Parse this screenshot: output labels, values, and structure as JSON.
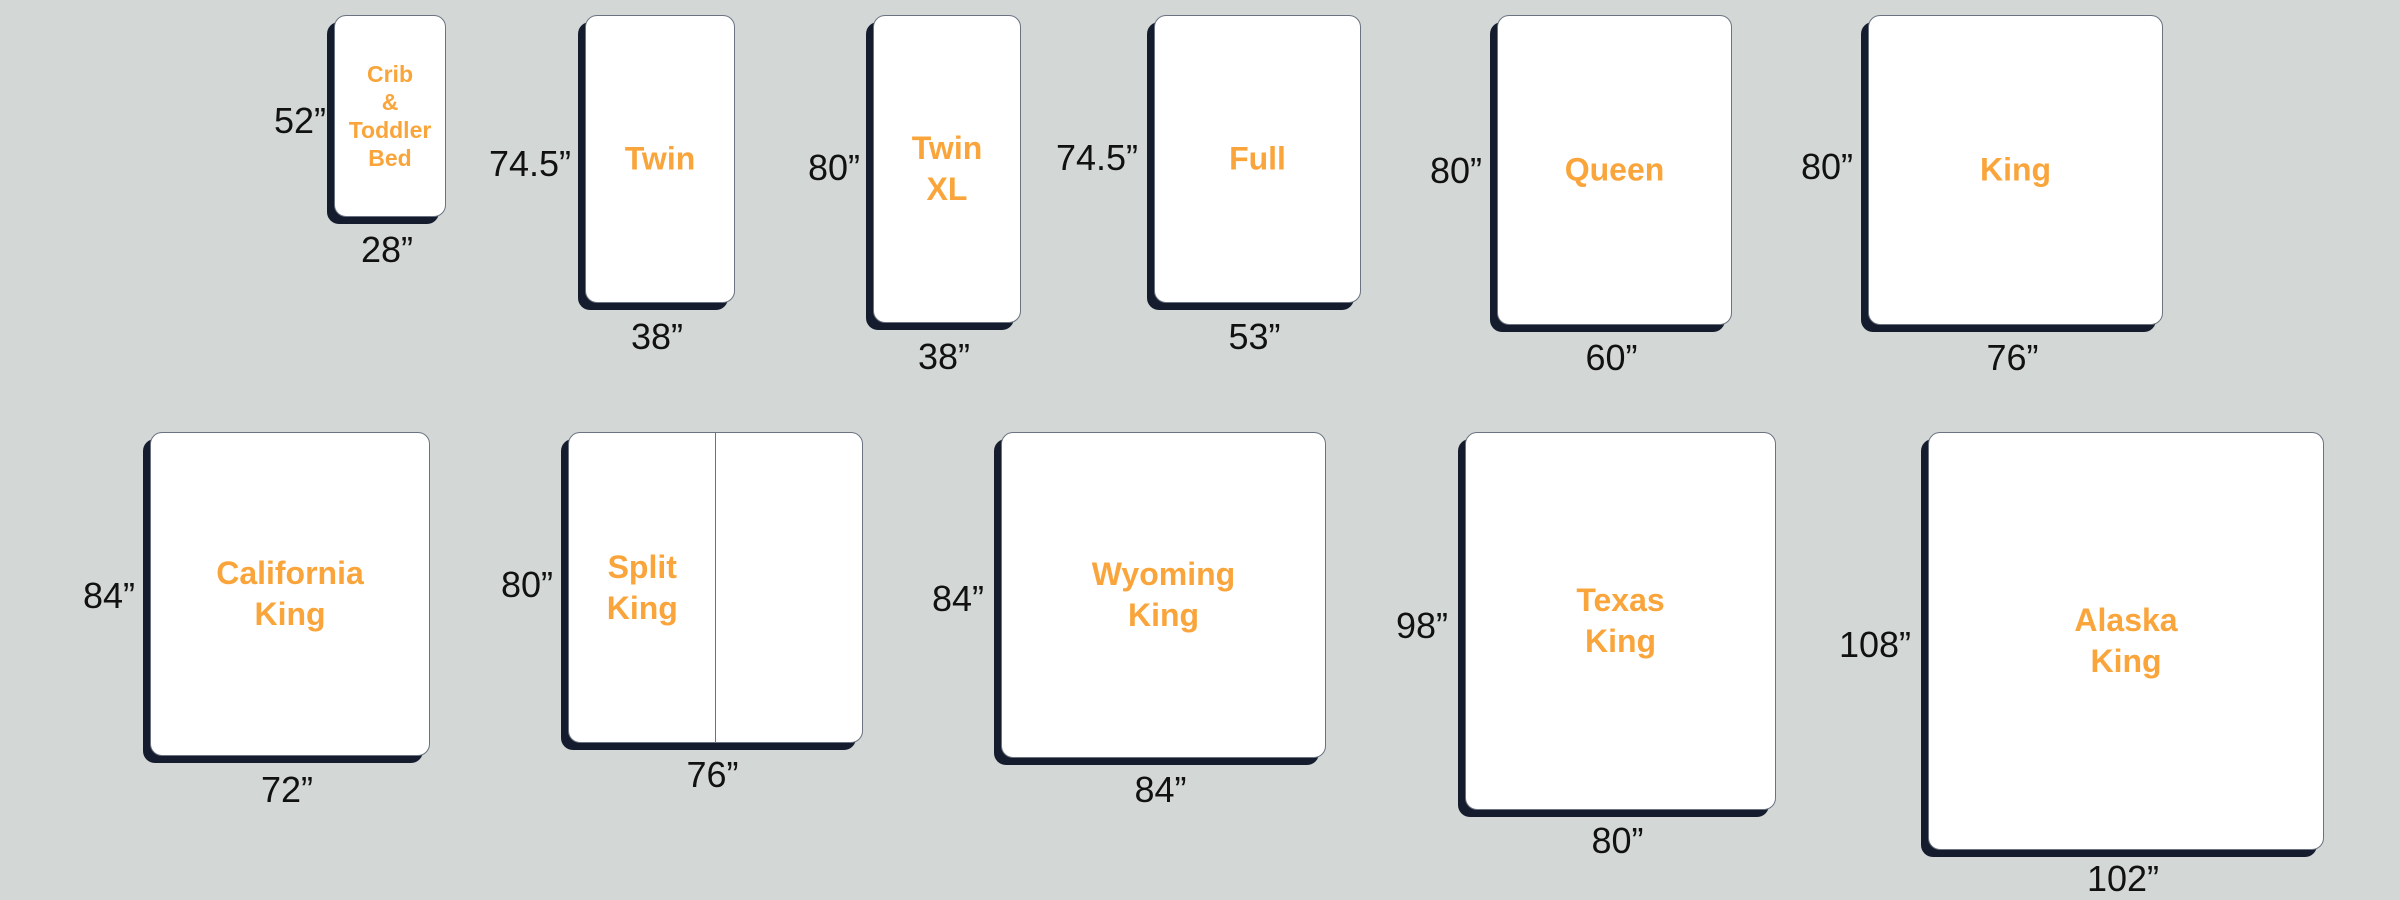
{
  "colors": {
    "background": "#d3d7d6",
    "mattress": "#ffffff",
    "shadow": "#141c2e",
    "label": "#f9a53b",
    "dimension_text": "#111111"
  },
  "beds": [
    {
      "id": "crib",
      "name_lines": [
        "Crib",
        "&",
        "Toddler",
        "Bed"
      ],
      "width": "28”",
      "length": "52”"
    },
    {
      "id": "twin",
      "name_lines": [
        "Twin"
      ],
      "width": "38”",
      "length": "74.5”"
    },
    {
      "id": "twin-xl",
      "name_lines": [
        "Twin",
        "XL"
      ],
      "width": "38”",
      "length": "80”"
    },
    {
      "id": "full",
      "name_lines": [
        "Full"
      ],
      "width": "53”",
      "length": "74.5”"
    },
    {
      "id": "queen",
      "name_lines": [
        "Queen"
      ],
      "width": "60”",
      "length": "80”"
    },
    {
      "id": "king",
      "name_lines": [
        "King"
      ],
      "width": "76”",
      "length": "80”"
    },
    {
      "id": "california-king",
      "name_lines": [
        "California",
        "King"
      ],
      "width": "72”",
      "length": "84”"
    },
    {
      "id": "split-king",
      "name_lines": [
        "Split",
        "King"
      ],
      "width": "76”",
      "length": "80”",
      "split": true
    },
    {
      "id": "wyoming-king",
      "name_lines": [
        "Wyoming",
        "King"
      ],
      "width": "84”",
      "length": "84”"
    },
    {
      "id": "texas-king",
      "name_lines": [
        "Texas",
        "King"
      ],
      "width": "80”",
      "length": "98”"
    },
    {
      "id": "alaska-king",
      "name_lines": [
        "Alaska",
        "King"
      ],
      "width": "102”",
      "length": "108”"
    }
  ]
}
